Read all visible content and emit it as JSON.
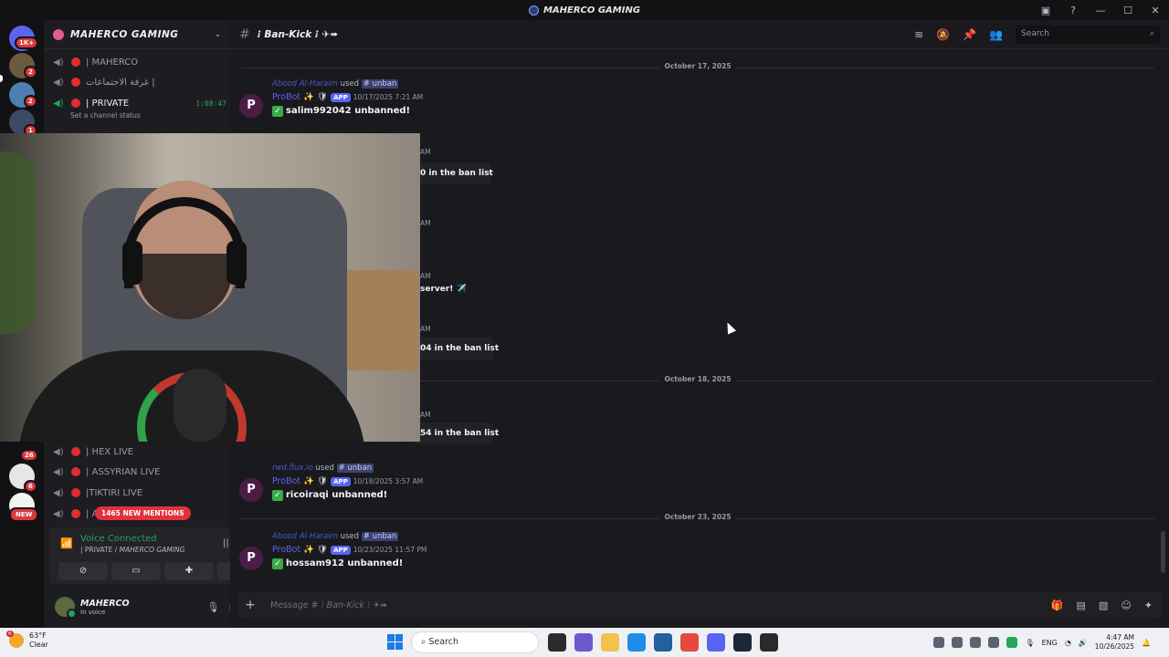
{
  "window": {
    "title": "MAHERCO GAMING"
  },
  "servers": {
    "badges": [
      "1K+",
      "2",
      "2",
      "1",
      "26",
      "6"
    ],
    "new_label": "NEW"
  },
  "guild": {
    "name": "MAHERCO GAMING"
  },
  "voice_channels": [
    {
      "name": "| MAHERCO"
    },
    {
      "name": "غرفة الاجتماعات |"
    },
    {
      "name": "| PRIVATE",
      "time": "1:08:47"
    },
    {
      "name": "| HEX LIVE"
    },
    {
      "name": "| ASSYRIAN LIVE"
    },
    {
      "name": "|TIKTIRI LIVE"
    },
    {
      "name": "| A"
    }
  ],
  "channel_status": "Set a channel status",
  "mentions": "1465 NEW MENTIONS",
  "voice": {
    "status": "Voice Connected",
    "channel": "| PRIVATE / ",
    "server": "MAHERCO GAMING"
  },
  "user": {
    "name": "MAHERCO",
    "status": "In voice"
  },
  "chat": {
    "channel": "⁝ Ban-Kick ⁝ ✈➠",
    "search_placeholder": "Search",
    "dates": [
      "October 17, 2025",
      "October 18, 2025",
      "October 23, 2025"
    ],
    "messages": [
      {
        "replier": "Abood Al-Haraim",
        "used": "used",
        "command": "# unban",
        "bot": "ProBot",
        "app": "APP",
        "timestamp": "10/17/2025 7:21 AM",
        "text": "salim992042 unbanned!"
      },
      {
        "replier": "rwd.flux.io",
        "used": "used",
        "command": "# unban",
        "bot": "ProBot",
        "app": "APP",
        "timestamp": "10/18/2025 3:57 AM",
        "text": "ricoiraqi unbanned!"
      },
      {
        "replier": "Abood Al-Haraim",
        "used": "used",
        "command": "# unban",
        "bot": "ProBot",
        "app": "APP",
        "timestamp": "10/23/2025 11:57 PM",
        "text": "hossam912 unbanned!"
      }
    ],
    "fragments": [
      "0 in the ban list",
      "server! ✈️",
      "04 in the ban list",
      "54 in the ban list"
    ],
    "am": "AM",
    "composer_placeholder": "Message # ",
    "composer_channel": "⁝ Ban-Kick ⁝ ✈➠"
  },
  "taskbar": {
    "temp": "63°F",
    "condition": "Clear",
    "weather_badge": "6",
    "search": "Search",
    "lang": "ENG",
    "time": "4:47 AM",
    "date": "10/26/2025"
  }
}
